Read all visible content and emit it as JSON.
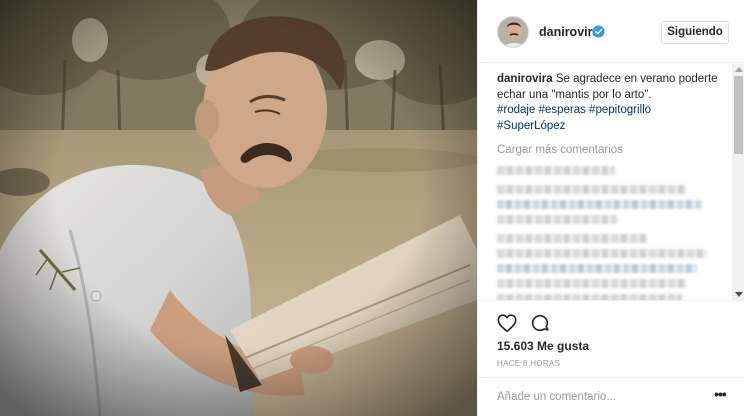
{
  "post": {
    "username": "danirovira",
    "follow_label": "Siguiendo",
    "caption_user": "danirovira",
    "caption_text": "Se agradece en verano poderte echar una \"mantis por lo arto\".",
    "hashtags": "#rodaje #esperas #pepitogrillo #SuperLópez",
    "load_more_label": "Cargar más comentarios",
    "likes": "15.603 Me gusta",
    "time_ago": "HACE 8 HORAS",
    "comment_placeholder": "Añade un comentario...",
    "more_options_glyph": "•••"
  },
  "icons": {
    "verified": "verified-badge-icon",
    "like": "heart-icon",
    "comment": "comment-bubble-icon",
    "more": "more-options-icon"
  },
  "colors": {
    "verified": "#3897f0",
    "hashtag": "#003569",
    "muted": "#999999",
    "border": "#efefef"
  }
}
